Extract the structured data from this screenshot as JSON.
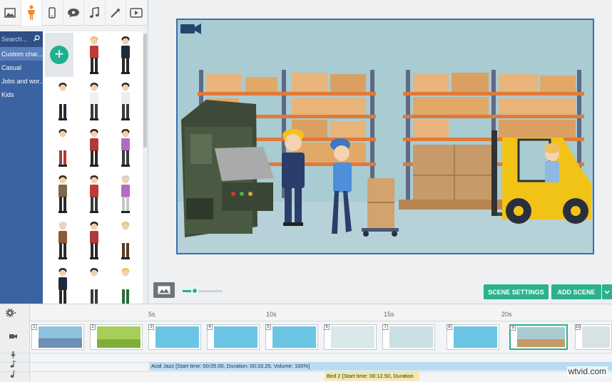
{
  "toolbar": {
    "tools": [
      "image-icon",
      "character-icon",
      "phone-icon",
      "speech-bubble-icon",
      "music-icon",
      "magic-wand-icon",
      "video-icon"
    ]
  },
  "sidebar": {
    "search_placeholder": "Search...",
    "categories": [
      "Custom char...",
      "Casual",
      "Jobs and wor...",
      "Kids"
    ]
  },
  "stage": {},
  "buttons": {
    "scene_settings": "SCENE SETTINGS",
    "add_scene": "ADD SCENE"
  },
  "timeline": {
    "ruler": [
      "5s",
      "10s",
      "15s",
      "20s"
    ],
    "scene_numbers": [
      "1",
      "2",
      "3",
      "4",
      "5",
      "6",
      "7",
      "8",
      "9",
      "10"
    ],
    "audio_track_1": "Acid Jazz [Start time: 00:05.00, Duration: 00:33.25, Volume: 100%]",
    "audio_track_2": "Bird 2 [Start time: 00:12.50, Duration"
  },
  "watermark": "wtvid.com",
  "colors": {
    "accent": "#2bb18d",
    "sidebar": "#3c63a1",
    "stage_border": "#3b6fb0"
  }
}
